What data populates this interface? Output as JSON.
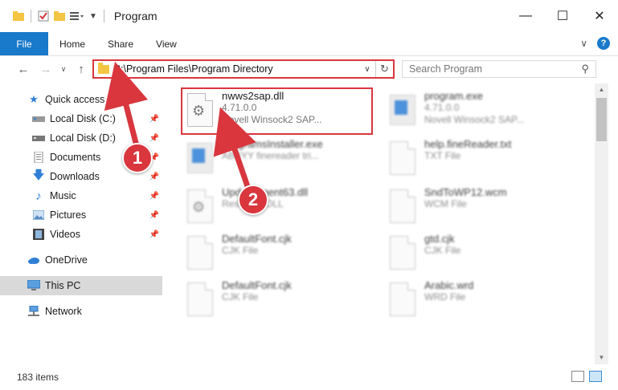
{
  "window": {
    "title": "Program",
    "minimize_glyph": "—",
    "maximize_glyph": "☐",
    "close_glyph": "✕"
  },
  "ribbon": {
    "tabs": [
      "File",
      "Home",
      "Share",
      "View"
    ],
    "expand_glyph": "∨",
    "help_glyph": "?"
  },
  "address_bar": {
    "path": "C:\\Program Files\\Program Directory"
  },
  "search": {
    "placeholder": "Search Program"
  },
  "sidebar": {
    "items": [
      {
        "label": "Quick access",
        "icon": "star-icon",
        "pinned": false
      },
      {
        "label": "Local Disk (C:)",
        "icon": "drive-icon",
        "pinned": true
      },
      {
        "label": "Local Disk (D:)",
        "icon": "drive-icon",
        "pinned": true
      },
      {
        "label": "Documents",
        "icon": "documents-icon",
        "pinned": true
      },
      {
        "label": "Downloads",
        "icon": "download-icon",
        "pinned": true
      },
      {
        "label": "Music",
        "icon": "music-icon",
        "pinned": true
      },
      {
        "label": "Pictures",
        "icon": "pictures-icon",
        "pinned": true
      },
      {
        "label": "Videos",
        "icon": "videos-icon",
        "pinned": true
      },
      {
        "label": "OneDrive",
        "icon": "cloud-icon",
        "pinned": false
      },
      {
        "label": "This PC",
        "icon": "computer-icon",
        "pinned": false,
        "selected": true
      },
      {
        "label": "Network",
        "icon": "network-icon",
        "pinned": false
      }
    ]
  },
  "files": [
    {
      "name": "nwws2sap.dll",
      "line2": "4.71.0.0",
      "line3": "Novell Winsock2 SAP...",
      "icon": "dll-gear-icon",
      "highlighted": true
    },
    {
      "name": "program.exe",
      "line2": "4.71.0.0",
      "line3": "Novell Winsock2 SAP...",
      "icon": "exe-icon"
    },
    {
      "name": "ProgramsInstaller.exe",
      "line2": "ABBYY finereader tri...",
      "line3": "",
      "icon": "installer-icon"
    },
    {
      "name": "help.fineReader.txt",
      "line2": "TXT File",
      "line3": "",
      "icon": "txt-icon"
    },
    {
      "name": "UpdateAgent63.dll",
      "line2": "Resource DLL",
      "line3": "",
      "icon": "dll-gear-icon"
    },
    {
      "name": "SndToWP12.wcm",
      "line2": "WCM File",
      "line3": "",
      "icon": "file-icon"
    },
    {
      "name": "DefaultFont.cjk",
      "line2": "CJK File",
      "line3": "",
      "icon": "file-icon"
    },
    {
      "name": "gtd.cjk",
      "line2": "CJK File",
      "line3": "",
      "icon": "file-icon"
    },
    {
      "name": "DefaultFont.cjk",
      "line2": "CJK File",
      "line3": "",
      "icon": "file-icon"
    },
    {
      "name": "Arabic.wrd",
      "line2": "WRD File",
      "line3": "",
      "icon": "file-icon"
    }
  ],
  "status": {
    "item_count": "183 items"
  },
  "annotations": {
    "step1": "1",
    "step2": "2",
    "color": "#d9363e"
  }
}
